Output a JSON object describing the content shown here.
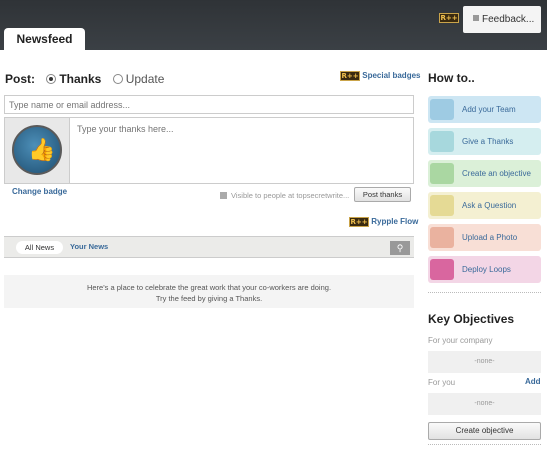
{
  "header": {
    "tab_label": "Newsfeed",
    "feedback_label": "Feedback...",
    "badge_glyph": "R++"
  },
  "post": {
    "label": "Post:",
    "option_thanks": "Thanks",
    "option_update": "Update",
    "selected": "Thanks",
    "special_badges": "Special badges",
    "name_placeholder": "Type name or email address...",
    "thanks_placeholder": "Type your thanks here...",
    "change_badge": "Change badge",
    "visibility_text": "Visible to people at topsecretwrite...",
    "post_button": "Post thanks",
    "rypple_flow": "Rypple Flow"
  },
  "news": {
    "tabs": [
      "All News",
      "Your News"
    ],
    "active_tab": "All News",
    "search_icon": "search-icon",
    "empty_line1": "Here's a place to celebrate the great work that your co-workers are doing.",
    "empty_line2": "Try the feed by giving a Thanks."
  },
  "howto": {
    "title": "How to..",
    "items": [
      {
        "label": "Add your Team",
        "color": "#cde6f3",
        "icon_color": "#9ecbe3"
      },
      {
        "label": "Give a Thanks",
        "color": "#d5eef0",
        "icon_color": "#a7d8dd"
      },
      {
        "label": "Create an objective",
        "color": "#dbf0d8",
        "icon_color": "#aad7a2"
      },
      {
        "label": "Ask a Question",
        "color": "#f4f0d2",
        "icon_color": "#e5da95"
      },
      {
        "label": "Upload a Photo",
        "color": "#f8dfd6",
        "icon_color": "#eab29f"
      },
      {
        "label": "Deploy Loops",
        "color": "#f3d6e6",
        "icon_color": "#d9669f"
      }
    ]
  },
  "objectives": {
    "title": "Key Objectives",
    "company_label": "For your company",
    "company_value": "-none-",
    "you_label": "For you",
    "add_link": "Add",
    "you_value": "-none-",
    "create_button": "Create objective"
  }
}
